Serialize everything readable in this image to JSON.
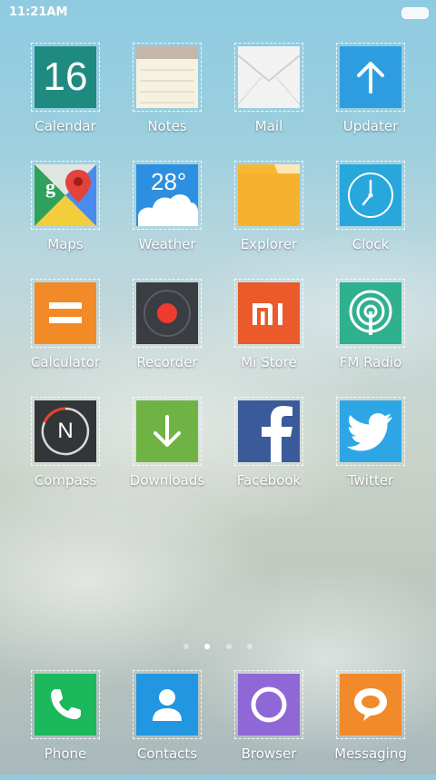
{
  "status_bar": {
    "time": "11:21AM"
  },
  "apps": {
    "calendar": {
      "label": "Calendar",
      "date": "16",
      "color": "#1f8a80"
    },
    "notes": {
      "label": "Notes"
    },
    "mail": {
      "label": "Mail"
    },
    "updater": {
      "label": "Updater",
      "color": "#2e9de0"
    },
    "maps": {
      "label": "Maps"
    },
    "weather": {
      "label": "Weather",
      "temp": "28°",
      "color": "#2d8fe0"
    },
    "explorer": {
      "label": "Explorer",
      "color": "#f6b22e"
    },
    "clock": {
      "label": "Clock",
      "color": "#27a7dc"
    },
    "calculator": {
      "label": "Calculator",
      "color": "#f28a28"
    },
    "recorder": {
      "label": "Recorder",
      "color": "#3a3d42"
    },
    "mistore": {
      "label": "Mi Store",
      "color": "#ea5a2a"
    },
    "fmradio": {
      "label": "FM Radio",
      "color": "#2fb08e"
    },
    "compass": {
      "label": "Compass",
      "letter": "N",
      "color": "#333639"
    },
    "downloads": {
      "label": "Downloads",
      "color": "#6fb345"
    },
    "facebook": {
      "label": "Facebook",
      "color": "#3b5a9a"
    },
    "twitter": {
      "label": "Twitter",
      "color": "#2ea6e6"
    }
  },
  "dock": {
    "phone": {
      "label": "Phone",
      "color": "#1cb85c"
    },
    "contacts": {
      "label": "Contacts",
      "color": "#2296e0"
    },
    "browser": {
      "label": "Browser",
      "color": "#8f68d6"
    },
    "messaging": {
      "label": "Messaging",
      "color": "#f08a2a"
    }
  },
  "page_indicator": {
    "pages": 4,
    "current": 2
  }
}
